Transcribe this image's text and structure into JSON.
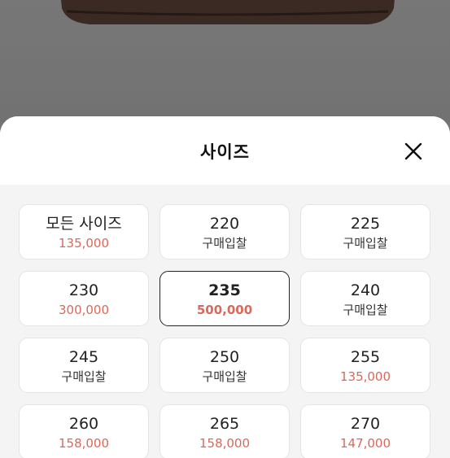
{
  "sheet": {
    "title": "사이즈"
  },
  "sizes": [
    {
      "label": "모든 사이즈",
      "price": "135,000",
      "type": "price"
    },
    {
      "label": "220",
      "price": "구매입찰",
      "type": "bid"
    },
    {
      "label": "225",
      "price": "구매입찰",
      "type": "bid"
    },
    {
      "label": "230",
      "price": "300,000",
      "type": "price"
    },
    {
      "label": "235",
      "price": "500,000",
      "type": "price",
      "selected": true
    },
    {
      "label": "240",
      "price": "구매입찰",
      "type": "bid"
    },
    {
      "label": "245",
      "price": "구매입찰",
      "type": "bid"
    },
    {
      "label": "250",
      "price": "구매입찰",
      "type": "bid"
    },
    {
      "label": "255",
      "price": "135,000",
      "type": "price"
    },
    {
      "label": "260",
      "price": "158,000",
      "type": "price"
    },
    {
      "label": "265",
      "price": "158,000",
      "type": "price"
    },
    {
      "label": "270",
      "price": "147,000",
      "type": "price"
    }
  ],
  "colors": {
    "price": "#d9695a",
    "bid": "#333333",
    "selected_border": "#222222"
  }
}
